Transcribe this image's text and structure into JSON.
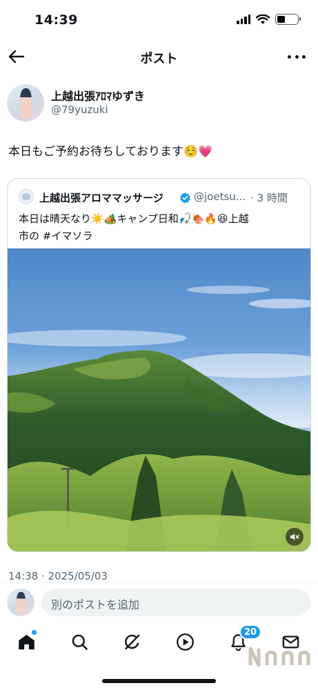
{
  "status_bar": {
    "time": "14:39"
  },
  "header": {
    "title": "ポスト"
  },
  "post": {
    "author": {
      "name": "上越出張ｱﾛﾏゆずき",
      "handle": "@79yuzuki"
    },
    "text": "本日もご予約お待ちしております☺️💗",
    "timestamp": "14:38 · 2025/05/03"
  },
  "quoted_post": {
    "author_name": "上越出張アロママッサージ",
    "handle": "@joetsu...",
    "time_separator": "·",
    "time": "3 時間",
    "text_line1": "本日は晴天なり☀️🏕️キャンプ日和🎣🍖🔥😆上越",
    "text_line2_prefix": "市の ",
    "hashtag": "#イマソラ"
  },
  "reply": {
    "placeholder": "別のポストを追加"
  },
  "tab_bar": {
    "items": [
      {
        "name": "home",
        "icon": "home-icon"
      },
      {
        "name": "search",
        "icon": "search-icon"
      },
      {
        "name": "grok",
        "icon": "grok-icon"
      },
      {
        "name": "video",
        "icon": "play-icon"
      },
      {
        "name": "notifications",
        "icon": "bell-icon"
      },
      {
        "name": "messages",
        "icon": "mail-icon"
      }
    ],
    "notification_count": "20"
  },
  "colors": {
    "accent": "#1d9bf0",
    "text_primary": "#0f1419",
    "text_secondary": "#536471"
  }
}
